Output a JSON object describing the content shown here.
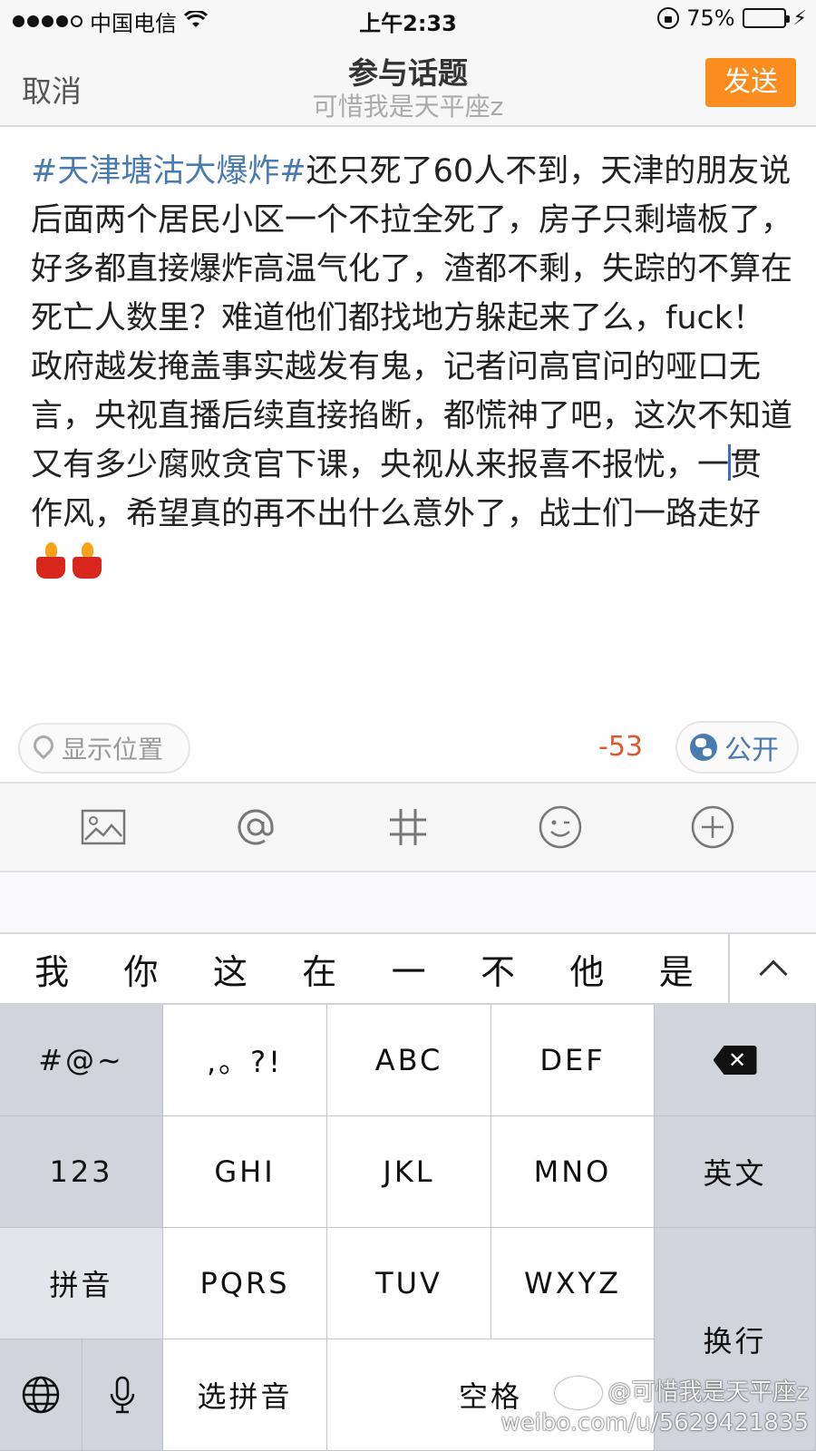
{
  "status": {
    "carrier": "中国电信",
    "time": "上午2:33",
    "battery": "75%",
    "battery_level": 0.75,
    "signal_icons": [
      "signal-dots-icon",
      "wifi-icon",
      "rotation-lock-icon",
      "battery-icon",
      "charging-icon"
    ]
  },
  "nav": {
    "cancel": "取消",
    "title": "参与话题",
    "subtitle": "可惜我是天平座z",
    "send": "发送",
    "send_color": "#fb8c1e"
  },
  "compose": {
    "topic": "#天津塘沽大爆炸#",
    "text_before_cursor": "还只死了60人不到，天津的朋友说后面两个居民小区一个不拉全死了，房子只剩墙板了，好多都直接爆炸高温气化了，渣都不剩，失踪的不算在死亡人数里？难道他们都找地方躲起来了么，fuck！政府越发掩盖事实越发有鬼，记者问高官问的哑口无言，央视直播后续直接掐断，都慌神了吧，这次不知道又有多少腐败贪官下课，央视从来报喜不报忧，一",
    "text_after_cursor": "贯作风，希望真的再不出什么意外了，战士们一路走好",
    "emoji": [
      "candle-icon",
      "candle-icon"
    ],
    "topic_color": "#4a7bb0"
  },
  "meta": {
    "location": "显示位置",
    "remaining": "-53",
    "visibility": "公开"
  },
  "toolbar": [
    "image-icon",
    "at-icon",
    "hashtag-icon",
    "emoji-icon",
    "add-icon"
  ],
  "candidates": {
    "words": [
      "我",
      "你",
      "这",
      "在",
      "一",
      "不",
      "他",
      "是"
    ]
  },
  "keyboard": {
    "symbols": "#@~",
    "punct": ",。?!",
    "abc": "ABC",
    "def": "DEF",
    "num": "123",
    "ghi": "GHI",
    "jkl": "JKL",
    "mno": "MNO",
    "english": "英文",
    "pinyin": "拼音",
    "pqrs": "PQRS",
    "tuv": "TUV",
    "wxyz": "WXYZ",
    "enter": "换行",
    "select_pinyin": "选拼音",
    "space": "空格"
  },
  "watermark": {
    "handle": "@可惜我是天平座z",
    "url": "weibo.com/u/5629421835"
  }
}
